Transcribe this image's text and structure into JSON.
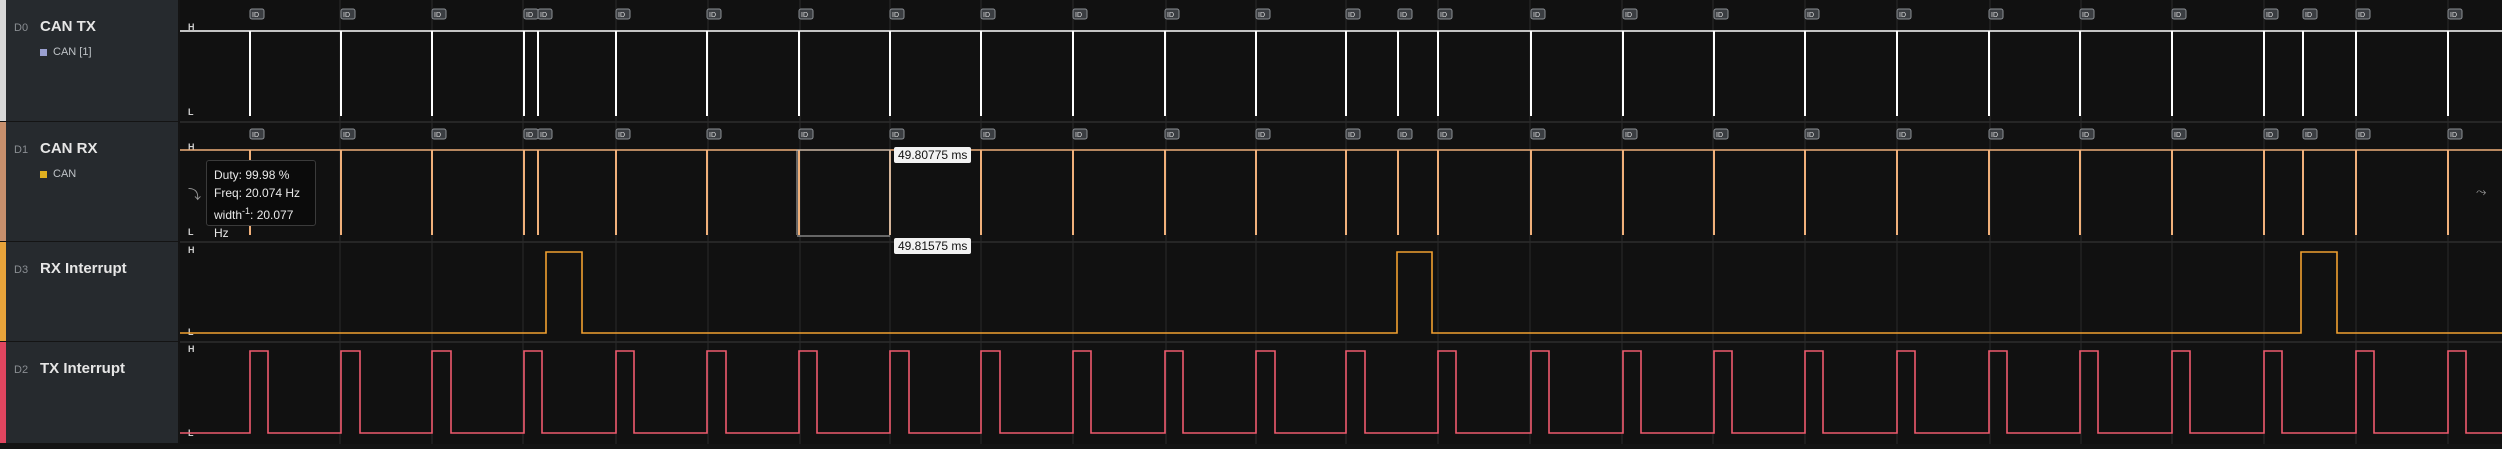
{
  "lanes": [
    {
      "channel": "D0",
      "name": "CAN TX",
      "analyzer": "CAN [1]",
      "stripe": "#d7d7d7",
      "swatch": "#9aa0d0",
      "wave_color": "#ffffff"
    },
    {
      "channel": "D1",
      "name": "CAN RX",
      "analyzer": "CAN",
      "stripe": "#c78f6c",
      "swatch": "#e0b020",
      "wave_color": "#f0b07a"
    },
    {
      "channel": "D3",
      "name": "RX Interrupt",
      "analyzer": "",
      "stripe": "#e8a33a",
      "swatch": "",
      "wave_color": "#f0a030"
    },
    {
      "channel": "D2",
      "name": "TX Interrupt",
      "analyzer": "",
      "stripe": "#e0455f",
      "swatch": "",
      "wave_color": "#ee5a6e"
    }
  ],
  "level_labels": {
    "high": "H",
    "low": "L"
  },
  "frame_label": "ID",
  "tooltip": {
    "duty": "Duty: 99.98 %",
    "freq": "Freq: 20.074 Hz",
    "width_prefix": "width",
    "width_sup": "-1",
    "width_value": ": 20.077 Hz"
  },
  "measurements": {
    "upper": "49.80775 ms",
    "lower": "49.81575 ms"
  },
  "icons": {
    "left_measure": "measure-icon",
    "right_measure": "measure-icon"
  }
}
